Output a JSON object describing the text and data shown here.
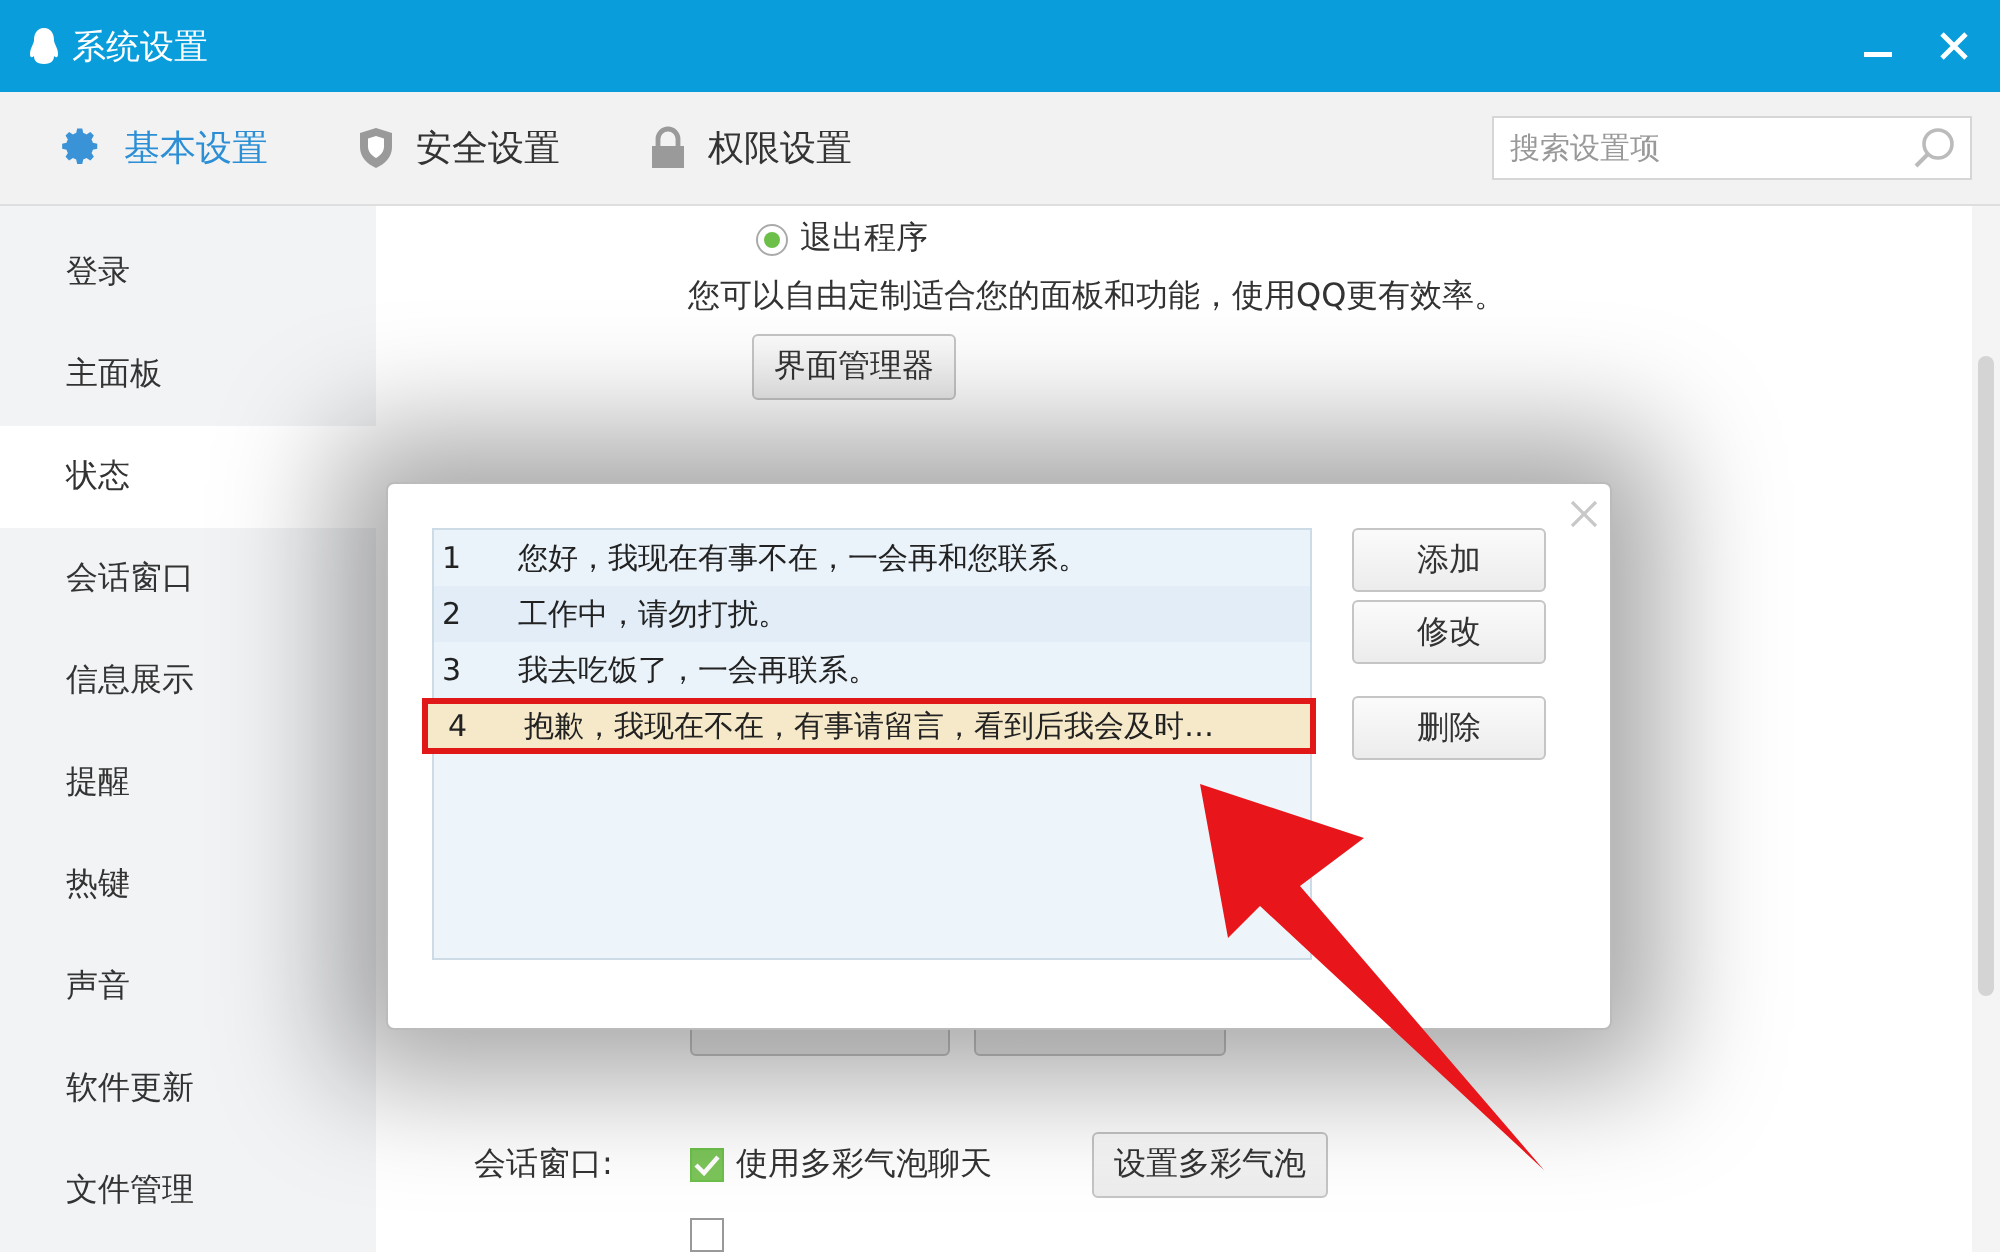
{
  "window": {
    "title": "系统设置"
  },
  "tabs": [
    {
      "label": "基本设置",
      "selected": true
    },
    {
      "label": "安全设置",
      "selected": false
    },
    {
      "label": "权限设置",
      "selected": false
    }
  ],
  "search": {
    "placeholder": "搜索设置项"
  },
  "sidebar": {
    "items": [
      {
        "label": "登录",
        "selected": false
      },
      {
        "label": "主面板",
        "selected": false
      },
      {
        "label": "状态",
        "selected": true
      },
      {
        "label": "会话窗口",
        "selected": false
      },
      {
        "label": "信息展示",
        "selected": false
      },
      {
        "label": "提醒",
        "selected": false
      },
      {
        "label": "热键",
        "selected": false
      },
      {
        "label": "声音",
        "selected": false
      },
      {
        "label": "软件更新",
        "selected": false
      },
      {
        "label": "文件管理",
        "selected": false
      }
    ]
  },
  "content": {
    "exit_radio": {
      "label": "退出程序",
      "selected": true
    },
    "description": "您可以自由定制适合您的面板和功能，使用QQ更有效率。",
    "manager_button": "界面管理器",
    "session_window": {
      "label": "会话窗口:",
      "bubble_checkbox": {
        "label": "使用多彩气泡聊天",
        "checked": true
      },
      "bubble_button": "设置多彩气泡",
      "ads_checkbox": {
        "checked": false
      }
    }
  },
  "dialog": {
    "messages": [
      {
        "number": "1",
        "text": "您好，我现在有事不在，一会再和您联系。",
        "selected": false
      },
      {
        "number": "2",
        "text": "工作中，请勿打扰。",
        "selected": false
      },
      {
        "number": "3",
        "text": "我去吃饭了，一会再联系。",
        "selected": false
      },
      {
        "number": "4",
        "text": "抱歉，我现在不在，有事请留言，看到后我会及时…",
        "selected": true
      }
    ],
    "buttons": [
      "添加",
      "修改",
      "删除"
    ]
  }
}
